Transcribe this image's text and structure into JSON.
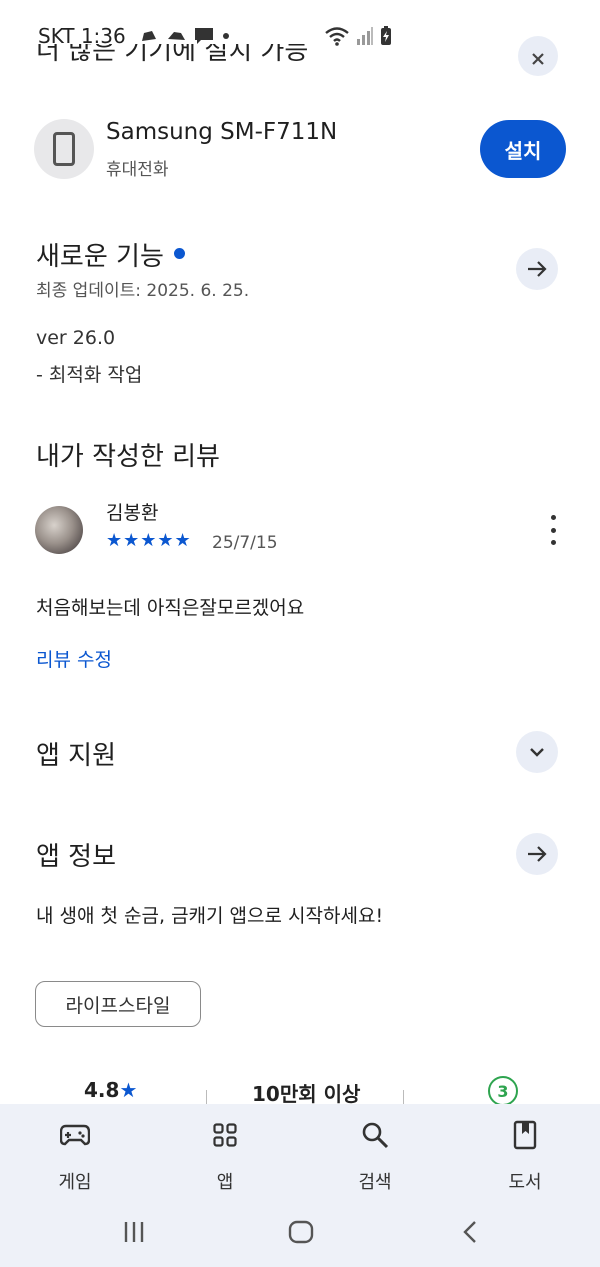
{
  "status_bar": {
    "carrier_time": "SKT 1:36"
  },
  "install_section": {
    "header_clipped": "더 많은 기기에 설치 가능",
    "device_name": "Samsung SM-F711N",
    "device_type": "휴대전화",
    "install_label": "설치"
  },
  "whats_new": {
    "title": "새로운 기능",
    "updated": "최종 업데이트: 2025. 6. 25.",
    "version": "ver 26.0",
    "note": "- 최적화 작업"
  },
  "my_review": {
    "title": "내가 작성한 리뷰",
    "reviewer": "김봉환",
    "stars": "★★★★★",
    "rating": 5,
    "date": "25/7/15",
    "text": "처음해보는데 아직은잘모르겠어요",
    "edit_label": "리뷰 수정"
  },
  "app_support": {
    "title": "앱 지원"
  },
  "app_info": {
    "title": "앱 정보",
    "description": "내 생애 첫 순금, 금캐기 앱으로 시작하세요!",
    "category": "라이프스타일"
  },
  "stats": {
    "rating": "4.8",
    "rating_star": "★",
    "downloads": "10만회 이상",
    "age": "3"
  },
  "bottom_nav": {
    "items": [
      {
        "label": "게임",
        "icon": "gamepad-icon"
      },
      {
        "label": "앱",
        "icon": "apps-grid-icon"
      },
      {
        "label": "검색",
        "icon": "search-icon"
      },
      {
        "label": "도서",
        "icon": "book-icon"
      }
    ]
  },
  "colors": {
    "accent": "#0b57d0",
    "nav_bg": "#eef1f8",
    "age_badge": "#2ea44f"
  }
}
